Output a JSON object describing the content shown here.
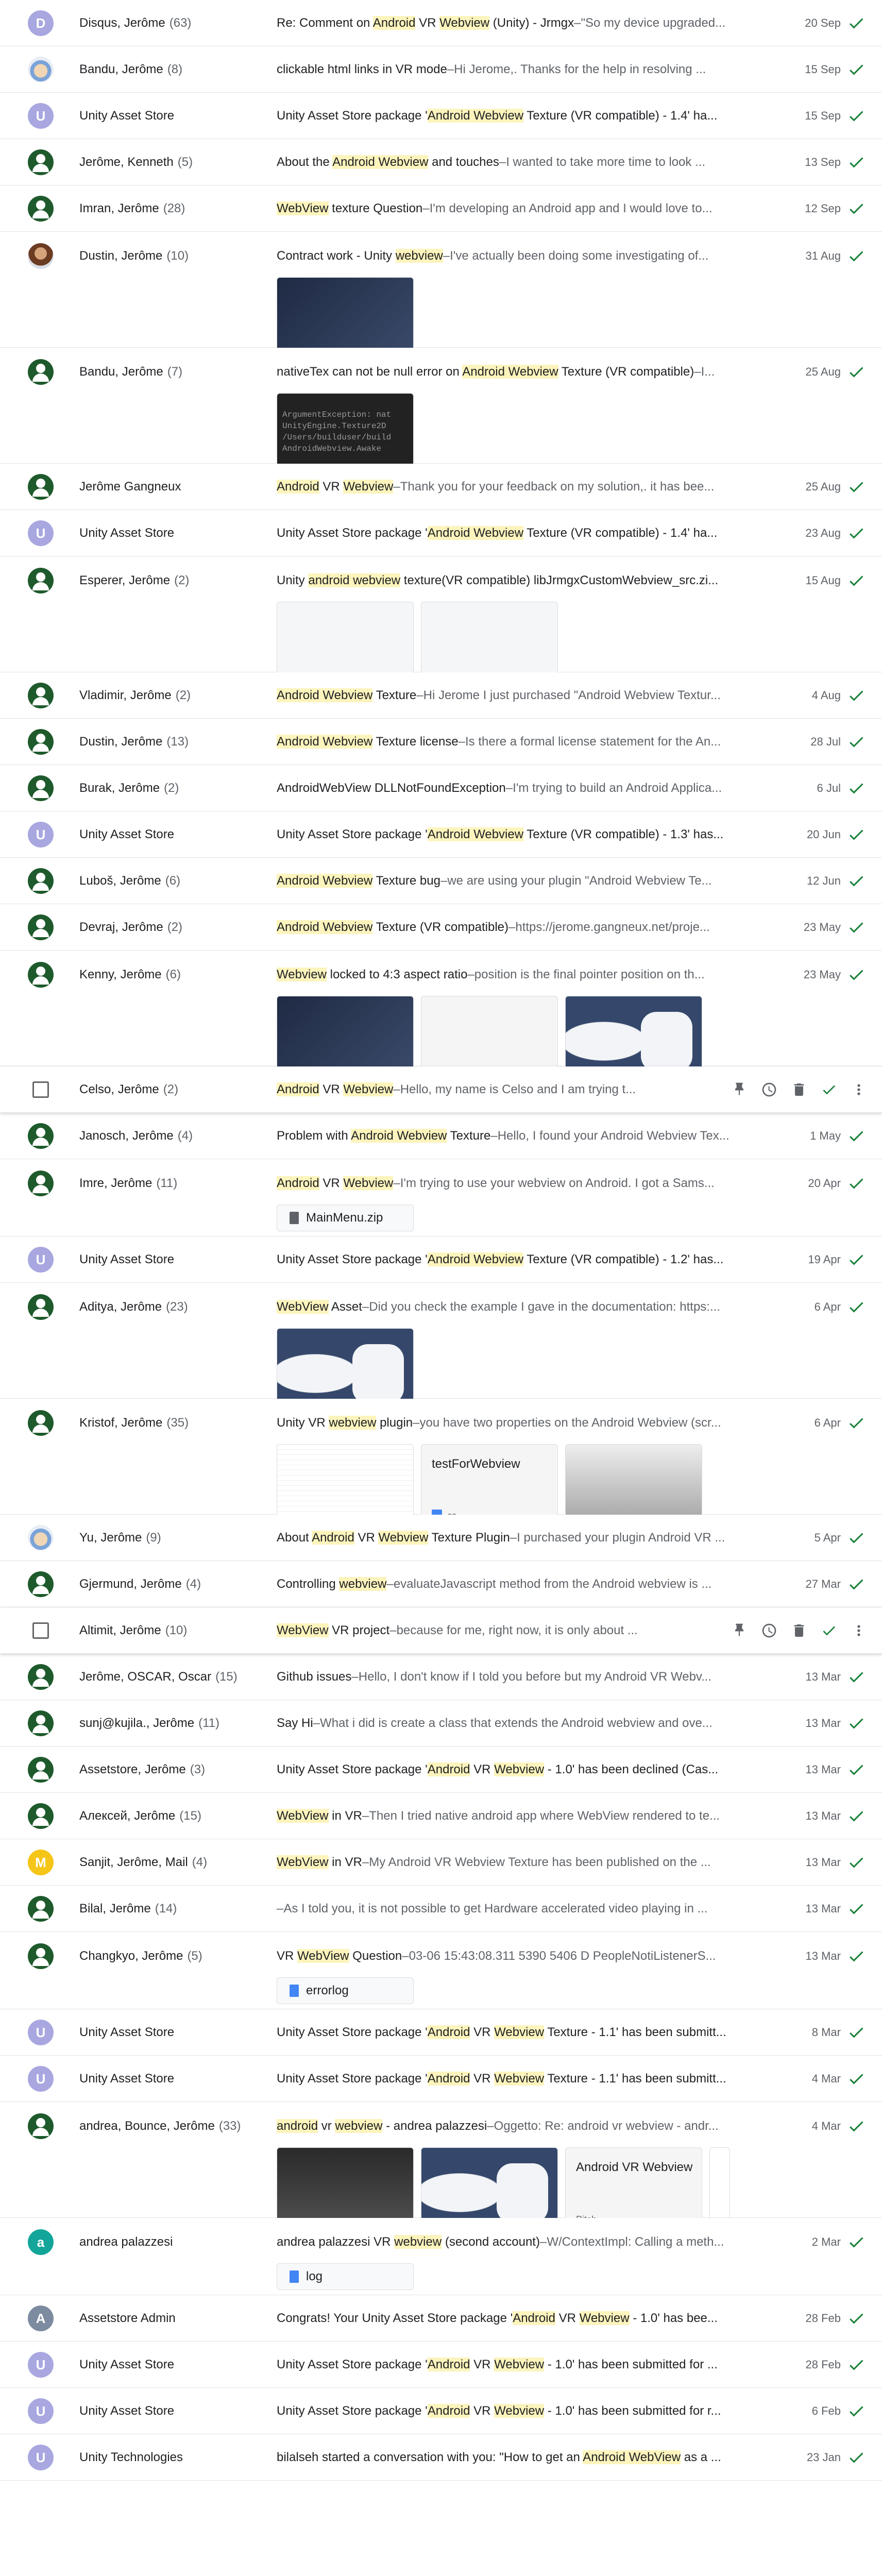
{
  "colors": {
    "check": "#188038",
    "highlight": "#fcf4bc",
    "avatar_green": "#1e5a2c",
    "avatar_lavender": "#a8a7e0"
  },
  "icons": {
    "done": "check-icon",
    "pin": "pin-icon",
    "snooze": "clock-icon",
    "delete": "trash-icon",
    "more": "more-vert-icon"
  },
  "rows": [
    {
      "av": "D",
      "avclass": "lav",
      "sender": "Disqus, Jerôme",
      "count": "(63)",
      "subject": [
        "Re: Comment on ",
        {
          "h": "Android"
        },
        " VR ",
        {
          "h": "Webview"
        },
        " (Unity) - Jrmgx"
      ],
      "snippet": "\"So my device upgraded...",
      "date": "20 Sep"
    },
    {
      "av": "",
      "avclass": "cartoon",
      "sender": "Bandu, Jerôme",
      "count": "(8)",
      "subject": [
        "clickable html links in VR mode"
      ],
      "snippet": "Hi Jerome,. Thanks for the help in resolving ...",
      "date": "15 Sep"
    },
    {
      "av": "U",
      "avclass": "lav",
      "sender": "Unity Asset Store",
      "count": "",
      "subject": [
        "Unity Asset Store package '",
        {
          "h": "Android Webview"
        },
        " Texture (VR compatible) - 1.4' ha..."
      ],
      "snippet": "",
      "date": "15 Sep"
    },
    {
      "av": "",
      "avclass": "green",
      "sender": "Jerôme, Kenneth",
      "count": "(5)",
      "subject": [
        "About the ",
        {
          "h": "Android Webview"
        },
        " and touches"
      ],
      "snippet": "I wanted to take more time to look ...",
      "date": "13 Sep"
    },
    {
      "av": "",
      "avclass": "green",
      "sender": "Imran, Jerôme",
      "count": "(28)",
      "subject": [
        {
          "h": "WebView"
        },
        " texture Question"
      ],
      "snippet": "I'm developing an Android app and I would love to...",
      "date": "12 Sep"
    },
    {
      "av": "",
      "avclass": "photo",
      "sender": "Dustin, Jerôme",
      "count": "(10)",
      "subject": [
        "Contract work - Unity ",
        {
          "h": "webview"
        }
      ],
      "snippet": "I've actually been doing some investigating of...",
      "date": "31 Aug",
      "thumbs": [
        "dark"
      ]
    },
    {
      "av": "",
      "avclass": "green",
      "sender": "Bandu, Jerôme",
      "count": "(7)",
      "subject": [
        "nativeTex can not be null error on ",
        {
          "h": "Android Webview"
        },
        " Texture (VR compatible)"
      ],
      "snippet": "I...",
      "date": "25 Aug",
      "thumbs": [
        "err"
      ]
    },
    {
      "av": "",
      "avclass": "green",
      "sender": "Jerôme Gangneux",
      "count": "",
      "subject": [
        {
          "h": "Android"
        },
        " VR ",
        {
          "h": "Webview"
        }
      ],
      "snippet": "Thank you for your feedback on my solution,. it has bee...",
      "date": "25 Aug"
    },
    {
      "av": "U",
      "avclass": "lav",
      "sender": "Unity Asset Store",
      "count": "",
      "subject": [
        "Unity Asset Store package '",
        {
          "h": "Android Webview"
        },
        " Texture (VR compatible) - 1.4' ha..."
      ],
      "snippet": "",
      "date": "23 Aug"
    },
    {
      "av": "",
      "avclass": "green",
      "sender": "Esperer, Jerôme",
      "count": "(2)",
      "subject": [
        "Unity ",
        {
          "h": "android webview"
        },
        " texture(VR compatible) libJrmgxCustomWebview_src.zi..."
      ],
      "snippet": "",
      "date": "15 Aug",
      "thumbs": [
        "tree",
        "tree"
      ]
    },
    {
      "av": "",
      "avclass": "green",
      "sender": "Vladimir, Jerôme",
      "count": "(2)",
      "subject": [
        {
          "h": "Android Webview"
        },
        " Texture"
      ],
      "snippet": "Hi Jerome I just purchased \"Android Webview Textur...",
      "date": "4 Aug"
    },
    {
      "av": "",
      "avclass": "green",
      "sender": "Dustin, Jerôme",
      "count": "(13)",
      "subject": [
        {
          "h": "Android Webview"
        },
        " Texture license"
      ],
      "snippet": "Is there a formal license statement for the An...",
      "date": "28 Jul"
    },
    {
      "av": "",
      "avclass": "green",
      "sender": "Burak, Jerôme",
      "count": "(2)",
      "subject": [
        "AndroidWebView DLLNotFoundException"
      ],
      "snippet": "I'm trying to build an Android Applica...",
      "date": "6 Jul"
    },
    {
      "av": "U",
      "avclass": "lav",
      "sender": "Unity Asset Store",
      "count": "",
      "subject": [
        "Unity Asset Store package '",
        {
          "h": "Android Webview"
        },
        " Texture (VR compatible) - 1.3' has..."
      ],
      "snippet": "",
      "date": "20 Jun"
    },
    {
      "av": "",
      "avclass": "green",
      "sender": "Luboš, Jerôme",
      "count": "(6)",
      "subject": [
        {
          "h": "Android Webview"
        },
        " Texture bug"
      ],
      "snippet": "we are using your plugin \"Android Webview Te...",
      "date": "12 Jun"
    },
    {
      "av": "",
      "avclass": "green",
      "sender": "Devraj, Jerôme",
      "count": "(2)",
      "subject": [
        {
          "h": "Android Webview"
        },
        " Texture (VR compatible)"
      ],
      "snippet": "https://jerome.gangneux.net/proje...",
      "date": "23 May"
    },
    {
      "av": "",
      "avclass": "green",
      "sender": "Kenny, Jerôme",
      "count": "(6)",
      "subject": [
        {
          "h": "Webview"
        },
        " locked to 4:3 aspect ratio"
      ],
      "snippet": "position is the final pointer position on th...",
      "date": "23 May",
      "thumbs": [
        "dark",
        "white",
        "vr"
      ]
    },
    {
      "av": "",
      "avclass": "cb",
      "sender": "Celso, Jerôme",
      "count": "(2)",
      "subject": [
        {
          "h": "Android"
        },
        " VR ",
        {
          "h": "Webview"
        }
      ],
      "snippet": "Hello, my name is Celso and I am trying t...",
      "date": "",
      "hover": true
    },
    {
      "av": "",
      "avclass": "green",
      "sender": "Janosch, Jerôme",
      "count": "(4)",
      "subject": [
        "Problem with ",
        {
          "h": "Android Webview"
        },
        " Texture"
      ],
      "snippet": "Hello, I found your Android Webview Tex...",
      "date": "1 May"
    },
    {
      "av": "",
      "avclass": "green",
      "sender": "Imre, Jerôme",
      "count": "(11)",
      "subject": [
        {
          "h": "Android"
        },
        " VR ",
        {
          "h": "Webview"
        }
      ],
      "snippet": "I'm trying to use your webview on Android. I got a Sams...",
      "date": "20 Apr",
      "chip": {
        "name": "MainMenu.zip",
        "gray": true
      }
    },
    {
      "av": "U",
      "avclass": "lav",
      "sender": "Unity Asset Store",
      "count": "",
      "subject": [
        "Unity Asset Store package '",
        {
          "h": "Android Webview"
        },
        " Texture (VR compatible) - 1.2' has..."
      ],
      "snippet": "",
      "date": "19 Apr"
    },
    {
      "av": "",
      "avclass": "green",
      "sender": "Aditya, Jerôme",
      "count": "(23)",
      "subject": [
        {
          "h": "WebView"
        },
        " Asset"
      ],
      "snippet": "Did you check the example I gave in the documentation: https:...",
      "date": "6 Apr",
      "thumbs": [
        "vr"
      ]
    },
    {
      "av": "",
      "avclass": "green",
      "sender": "Kristof, Jerôme",
      "count": "(35)",
      "subject": [
        "Unity VR ",
        {
          "h": "webview"
        },
        " plugin"
      ],
      "snippet": "you have two properties on the Android Webview (scr...",
      "date": "6 Apr",
      "thumbs": [
        "code",
        "file",
        "grey"
      ],
      "file": {
        "name": "testForWebview",
        "ext": "cs"
      }
    },
    {
      "av": "",
      "avclass": "cartoon",
      "sender": "Yu, Jerôme",
      "count": "(9)",
      "subject": [
        "About ",
        {
          "h": "Android"
        },
        " VR ",
        {
          "h": "Webview"
        },
        " Texture Plugin"
      ],
      "snippet": "I purchased your plugin Android VR ...",
      "date": "5 Apr"
    },
    {
      "av": "",
      "avclass": "green",
      "sender": "Gjermund, Jerôme",
      "count": "(4)",
      "subject": [
        "Controlling ",
        {
          "h": "webview"
        }
      ],
      "snippet": "evaluateJavascript method from the Android webview is ...",
      "date": "27 Mar"
    },
    {
      "av": "",
      "avclass": "cb",
      "sender": "Altimit, Jerôme",
      "count": "(10)",
      "subject": [
        {
          "h": "WebView"
        },
        " VR project"
      ],
      "snippet": "because for me, right now, it is only about ...",
      "date": "",
      "hover": true
    },
    {
      "av": "",
      "avclass": "green",
      "sender": "Jerôme, OSCAR, Oscar",
      "count": "(15)",
      "subject": [
        "Github issues"
      ],
      "snippet": "Hello, I don't know if I told you before but my Android VR Webv...",
      "date": "13 Mar"
    },
    {
      "av": "",
      "avclass": "green",
      "sender": "sunj@kujila., Jerôme",
      "count": "(11)",
      "subject": [
        "Say Hi"
      ],
      "snippet": "What i did is create a class that extends the Android webview and ove...",
      "date": "13 Mar"
    },
    {
      "av": "",
      "avclass": "green",
      "sender": "Assetstore, Jerôme",
      "count": "(3)",
      "subject": [
        "Unity Asset Store package '",
        {
          "h": "Android"
        },
        " VR ",
        {
          "h": "Webview"
        },
        " - 1.0' has been declined (Cas..."
      ],
      "snippet": "",
      "date": "13 Mar"
    },
    {
      "av": "",
      "avclass": "green",
      "sender": "Алексей, Jerôme",
      "count": "(15)",
      "subject": [
        {
          "h": "WebView"
        },
        " in VR"
      ],
      "snippet": "Then I tried native android app where WebView rendered to te...",
      "date": "13 Mar"
    },
    {
      "av": "M",
      "avclass": "yellow",
      "sender": "Sanjit, Jerôme, Mail",
      "count": "(4)",
      "subject": [
        {
          "h": "WebView"
        },
        " in VR"
      ],
      "snippet": "My Android VR Webview Texture has been published on the ...",
      "date": "13 Mar"
    },
    {
      "av": "",
      "avclass": "green",
      "sender": "Bilal, Jerôme",
      "count": "(14)",
      "subject": [
        ""
      ],
      "snippet": "As I told you, it is not possible to get Hardware accelerated video playing in ...",
      "date": "13 Mar"
    },
    {
      "av": "",
      "avclass": "green",
      "sender": "Changkyo, Jerôme",
      "count": "(5)",
      "subject": [
        "VR ",
        {
          "h": "WebView"
        },
        " Question"
      ],
      "snippet": "03-06 15:43:08.311 5390 5406 D PeopleNotiListenerS...",
      "date": "13 Mar",
      "chip": {
        "name": "errorlog",
        "gray": false
      }
    },
    {
      "av": "U",
      "avclass": "lav",
      "sender": "Unity Asset Store",
      "count": "",
      "subject": [
        "Unity Asset Store package '",
        {
          "h": "Android"
        },
        " VR ",
        {
          "h": "Webview"
        },
        " Texture - 1.1' has been submitt..."
      ],
      "snippet": "",
      "date": "8 Mar"
    },
    {
      "av": "U",
      "avclass": "lav",
      "sender": "Unity Asset Store",
      "count": "",
      "subject": [
        "Unity Asset Store package '",
        {
          "h": "Android"
        },
        " VR ",
        {
          "h": "Webview"
        },
        " Texture - 1.1' has been submitt..."
      ],
      "snippet": "",
      "date": "4 Mar"
    },
    {
      "av": "",
      "avclass": "green",
      "sender": "andrea, Bounce, Jerôme",
      "count": "(33)",
      "subject": [
        {
          "h": "android"
        },
        " vr ",
        {
          "h": "webview"
        },
        " - andrea palazzesi"
      ],
      "snippet": "Oggetto: Re: android vr webview - andr...",
      "date": "4 Mar",
      "thumbs": [
        "dark2",
        "vr",
        "white",
        "more"
      ],
      "card": {
        "title": "Android VR Webview",
        "sub": "Pitch"
      }
    },
    {
      "av": "a",
      "avclass": "teal",
      "sender": "andrea palazzesi",
      "count": "",
      "subject": [
        "andrea palazzesi VR ",
        {
          "h": "webview"
        },
        " (second account)"
      ],
      "snippet": "W/ContextImpl: Calling a meth...",
      "date": "2 Mar",
      "chip": {
        "name": "log",
        "gray": false
      }
    },
    {
      "av": "A",
      "avclass": "grey",
      "sender": "Assetstore Admin",
      "count": "",
      "subject": [
        "Congrats! Your Unity Asset Store package '",
        {
          "h": "Android"
        },
        " VR ",
        {
          "h": "Webview"
        },
        " - 1.0' has bee..."
      ],
      "snippet": "",
      "date": "28 Feb"
    },
    {
      "av": "U",
      "avclass": "lav",
      "sender": "Unity Asset Store",
      "count": "",
      "subject": [
        "Unity Asset Store package '",
        {
          "h": "Android"
        },
        " VR ",
        {
          "h": "Webview"
        },
        " - 1.0' has been submitted for ..."
      ],
      "snippet": "",
      "date": "28 Feb"
    },
    {
      "av": "U",
      "avclass": "lav",
      "sender": "Unity Asset Store",
      "count": "",
      "subject": [
        "Unity Asset Store package '",
        {
          "h": "Android"
        },
        " VR ",
        {
          "h": "Webview"
        },
        " - 1.0' has been submitted for r..."
      ],
      "snippet": "",
      "date": "6 Feb"
    },
    {
      "av": "U",
      "avclass": "lav",
      "sender": "Unity Technologies",
      "count": "",
      "subject": [
        "bilalseh started a conversation with you: \"How to get an ",
        {
          "h": "Android WebView"
        },
        " as a ..."
      ],
      "snippet": "",
      "date": "23 Jan"
    }
  ],
  "error_text": [
    "ArgumentException: nat",
    "UnityEngine.Texture2D",
    "/Users/builduser/build",
    "AndroidWebview.Awake"
  ]
}
